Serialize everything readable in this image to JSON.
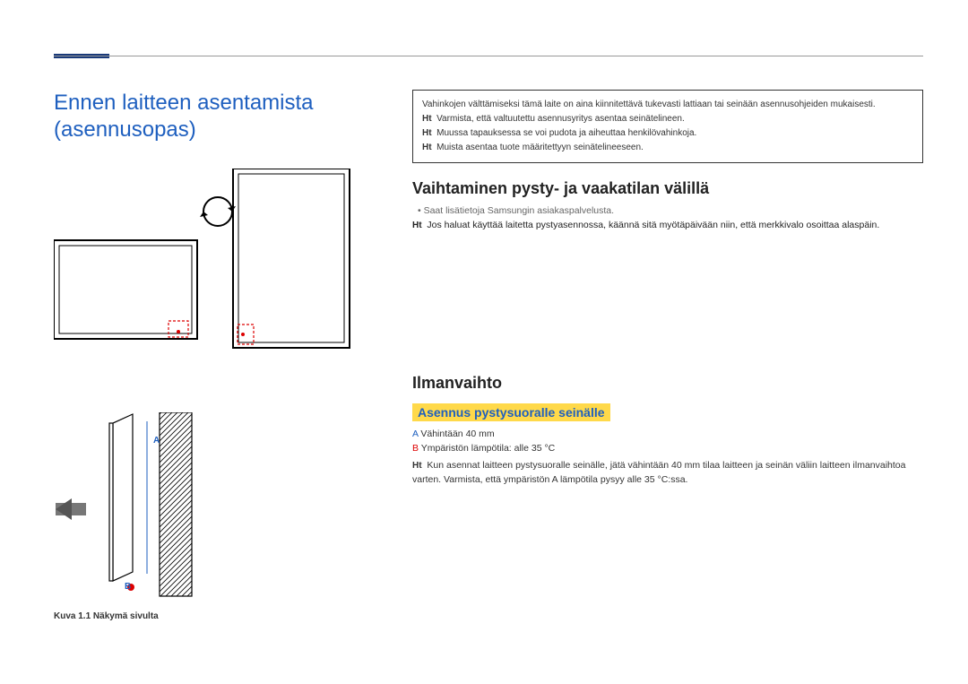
{
  "page_title_l1": "Ennen laitteen asentamista",
  "page_title_l2": "(asennusopas)",
  "infobox": {
    "line1": "Vahinkojen välttämiseksi tämä laite on aina kiinnitettävä tukevasti lattiaan tai seinään asennusohjeiden mukaisesti.",
    "h1": "Ht",
    "line2": "Varmista, että valtuutettu asennusyritys asentaa seinätelineen.",
    "h2": "Ht",
    "line3": "Muussa tapauksessa se voi pudota ja aiheuttaa henkilövahinkoja.",
    "h3": "Ht",
    "line4": "Muista asentaa tuote määritettyyn seinätelineeseen."
  },
  "section1": {
    "title": "Vaihtaminen pysty- ja vaakatilan välillä",
    "bullet": "Saat lisätietoja Samsungin asiakaspalvelusta.",
    "hint_label": "Ht",
    "hint_text": "Jos haluat käyttää laitetta pystyasennossa, käännä sitä myötäpäivään niin, että merkkivalo osoittaa alaspäin."
  },
  "section2": {
    "title": "Ilmanvaihto",
    "sub_title": "Asennus pystysuoralle seinälle",
    "specA_label": "A",
    "specA_text": " Vähintään 40 mm",
    "specB_label": "B",
    "specB_text": " Ympäristön lämpötila: alle 35 °C",
    "hint_label": "Ht",
    "hint_text": "Kun asennat laitteen pystysuoralle seinälle, jätä vähintään 40 mm tilaa laitteen ja seinän väliin laitteen ilmanvaihtoa varten. Varmista, että ympäristön A lämpötila pysyy alle 35 °C:ssa."
  },
  "figure": {
    "caption": "Kuva 1.1 Näkymä sivulta",
    "labelA": "A",
    "labelB": "B"
  }
}
